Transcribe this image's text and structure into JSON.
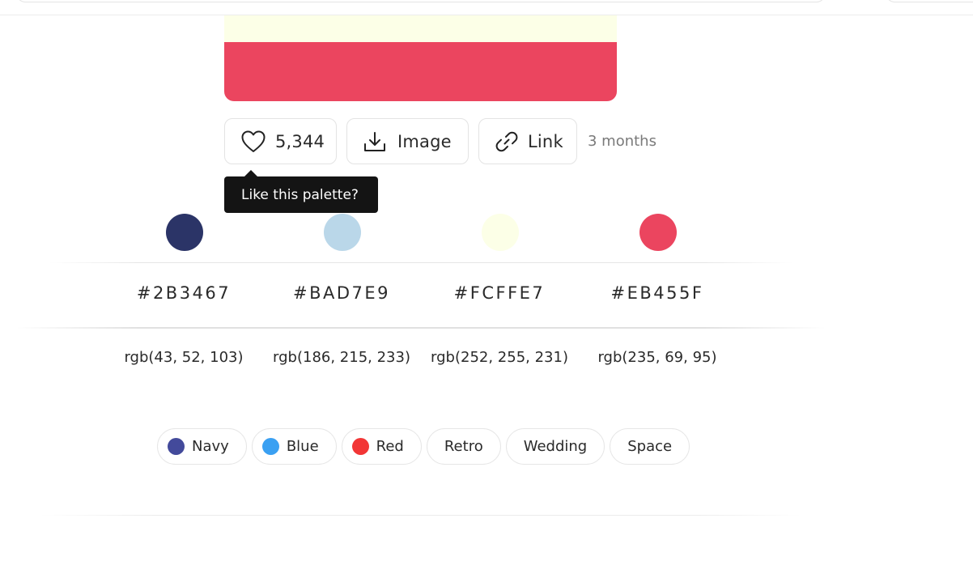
{
  "palette": {
    "colors": [
      {
        "hex": "#2B3467",
        "rgb": "rgb(43, 52, 103)",
        "swatch": "#2B3467"
      },
      {
        "hex": "#BAD7E9",
        "rgb": "rgb(186, 215, 233)",
        "swatch": "#BAD7E9"
      },
      {
        "hex": "#FCFFE7",
        "rgb": "rgb(252, 255, 231)",
        "swatch": "#FCFFE7"
      },
      {
        "hex": "#EB455F",
        "rgb": "rgb(235, 69, 95)",
        "swatch": "#EB455F"
      }
    ]
  },
  "actions": {
    "like_count": "5,344",
    "image_label": "Image",
    "link_label": "Link",
    "age": "3 months",
    "tooltip": "Like this palette?"
  },
  "tags": [
    {
      "label": "Navy",
      "dot": "#434A9B"
    },
    {
      "label": "Blue",
      "dot": "#3AA0F2"
    },
    {
      "label": "Red",
      "dot": "#F23636"
    },
    {
      "label": "Retro"
    },
    {
      "label": "Wedding"
    },
    {
      "label": "Space"
    }
  ],
  "icons": {
    "like": "heart-icon",
    "image": "download-icon",
    "link": "link-icon"
  }
}
